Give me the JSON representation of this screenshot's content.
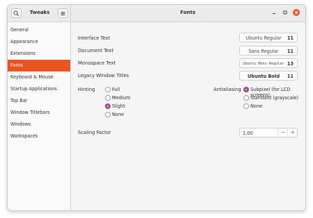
{
  "header": {
    "app_title": "Tweaks",
    "window_title": "Fonts",
    "icons": {
      "search": "search-icon",
      "menu": "hamburger-menu-icon",
      "minimize": "minimize-icon",
      "maximize": "maximize-icon",
      "close": "close-icon"
    }
  },
  "sidebar": {
    "items": [
      {
        "label": "General"
      },
      {
        "label": "Appearance"
      },
      {
        "label": "Extensions"
      },
      {
        "label": "Fonts"
      },
      {
        "label": "Keyboard & Mouse"
      },
      {
        "label": "Startup Applications"
      },
      {
        "label": "Top Bar"
      },
      {
        "label": "Window Titlebars"
      },
      {
        "label": "Windows"
      },
      {
        "label": "Workspaces"
      }
    ],
    "active": "Fonts"
  },
  "fonts": {
    "interface": {
      "label": "Interface Text",
      "font": "Ubuntu Regular",
      "size": "11"
    },
    "document": {
      "label": "Document Text",
      "font": "Sans Regular",
      "size": "11"
    },
    "monospace": {
      "label": "Monospace Text",
      "font": "Ubuntu Mono Regular",
      "size": "13"
    },
    "legacy": {
      "label": "Legacy Window Titles",
      "font": "Ubuntu Bold",
      "size": "11"
    }
  },
  "hinting": {
    "label": "Hinting",
    "options": [
      "Full",
      "Medium",
      "Slight",
      "None"
    ],
    "selected": "Slight"
  },
  "antialiasing": {
    "label": "Antialiasing",
    "options": [
      "Subpixel (for LCD screens)",
      "Standard (grayscale)",
      "None"
    ],
    "selected": "Subpixel (for LCD screens)"
  },
  "scaling": {
    "label": "Scaling Factor",
    "value": "1.00",
    "decrement": "−",
    "increment": "+"
  },
  "colors": {
    "accent": "#e95420",
    "radio": "#9a4a8a"
  }
}
